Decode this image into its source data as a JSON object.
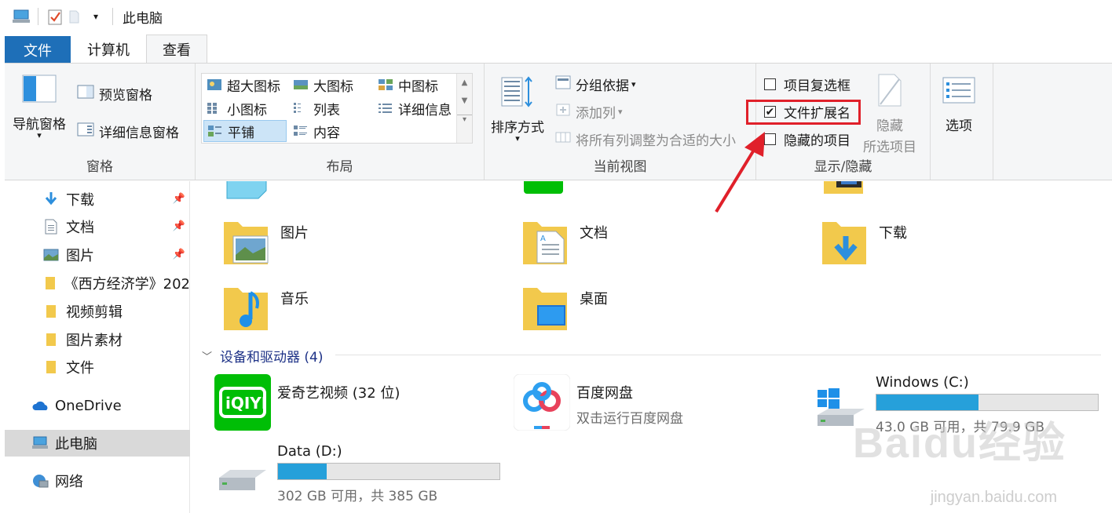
{
  "window": {
    "title": "此电脑"
  },
  "tabs": [
    {
      "label": "文件"
    },
    {
      "label": "计算机"
    },
    {
      "label": "查看"
    }
  ],
  "ribbon": {
    "pane": {
      "nav_pane": "导航窗格",
      "preview_pane": "预览窗格",
      "details_pane": "详细信息窗格",
      "label": "窗格"
    },
    "layout": {
      "items": [
        "超大图标",
        "大图标",
        "中图标",
        "小图标",
        "列表",
        "详细信息",
        "平铺",
        "内容"
      ],
      "selected": "平铺",
      "label": "布局"
    },
    "current_view": {
      "sort": "排序方式",
      "group_by": "分组依据",
      "add_column": "添加列",
      "fit_columns": "将所有列调整为合适的大小",
      "label": "当前视图"
    },
    "show_hide": {
      "item_checkboxes": "项目复选框",
      "file_extensions": "文件扩展名",
      "hidden_items": "隐藏的项目",
      "hide_selected_1": "隐藏",
      "hide_selected_2": "所选项目",
      "label": "显示/隐藏",
      "item_checkboxes_checked": false,
      "file_extensions_checked": true,
      "hidden_items_checked": false
    },
    "options": {
      "label": "选项"
    }
  },
  "nav": {
    "items": [
      {
        "label": "下载",
        "pinned": true
      },
      {
        "label": "文档",
        "pinned": true
      },
      {
        "label": "图片",
        "pinned": true
      },
      {
        "label": "《西方经济学》202",
        "pinned": false
      },
      {
        "label": "视频剪辑",
        "pinned": false
      },
      {
        "label": "图片素材",
        "pinned": false
      },
      {
        "label": "文件",
        "pinned": false
      },
      {
        "label": "OneDrive",
        "pinned": false
      },
      {
        "label": "此电脑",
        "pinned": false
      },
      {
        "label": "网络",
        "pinned": false
      }
    ]
  },
  "folders": [
    {
      "label": "图片"
    },
    {
      "label": "文档"
    },
    {
      "label": "下载"
    },
    {
      "label": "音乐"
    },
    {
      "label": "桌面"
    }
  ],
  "devices": {
    "section_title": "设备和驱动器 (4)",
    "items": [
      {
        "name": "爱奇艺视频 (32 位)",
        "sub": ""
      },
      {
        "name": "百度网盘",
        "sub": "双击运行百度网盘"
      },
      {
        "name": "Windows (C:)",
        "sub": "43.0 GB 可用，共 79.9 GB",
        "used_fraction": 0.46
      },
      {
        "name": "Data (D:)",
        "sub": "302 GB 可用，共 385 GB",
        "used_fraction": 0.22
      }
    ]
  },
  "watermark": {
    "text": "jingyan.baidu.com",
    "logo": "Baidu经验"
  },
  "colors": {
    "accent": "#1e6fb8",
    "highlight": "#e0202a",
    "bar": "#26a0da",
    "selected": "#cce4f7",
    "iqiyi": "#00be06"
  }
}
